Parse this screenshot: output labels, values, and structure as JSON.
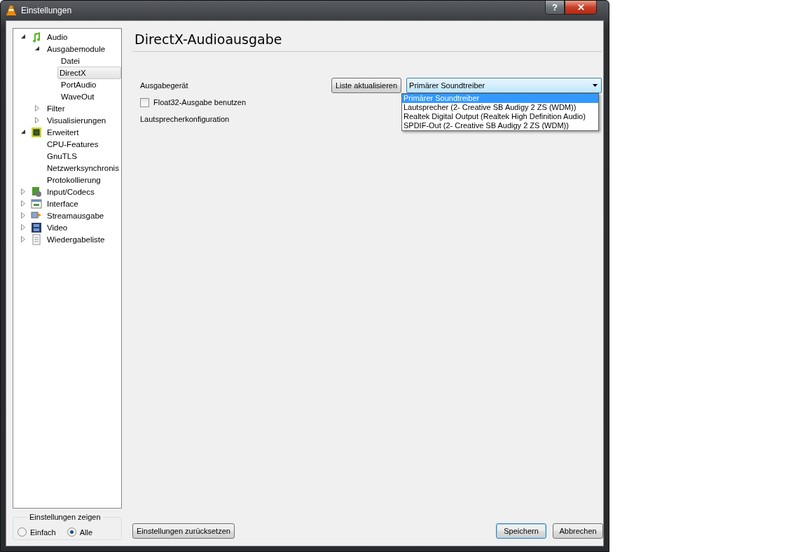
{
  "window": {
    "title": "Einstellungen",
    "help": "?",
    "close": "✕"
  },
  "tree": [
    {
      "label": "Audio",
      "expanded": true,
      "selected": false,
      "children": [
        {
          "label": "Ausgabemodule",
          "expanded": true,
          "selected": false,
          "children": [
            {
              "label": "Datei",
              "selected": false
            },
            {
              "label": "DirectX",
              "selected": true
            },
            {
              "label": "PortAudio",
              "selected": false
            },
            {
              "label": "WaveOut",
              "selected": false
            }
          ]
        },
        {
          "label": "Filter",
          "expanded": false,
          "selected": false
        },
        {
          "label": "Visualisierungen",
          "expanded": false,
          "selected": false
        }
      ]
    },
    {
      "label": "Erweitert",
      "expanded": true,
      "selected": false,
      "children": [
        {
          "label": "CPU-Features",
          "selected": false
        },
        {
          "label": "GnuTLS",
          "selected": false
        },
        {
          "label": "Netzwerksynchronis",
          "selected": false
        },
        {
          "label": "Protokollierung",
          "selected": false
        }
      ]
    },
    {
      "label": "Input/Codecs",
      "expanded": false,
      "selected": false
    },
    {
      "label": "Interface",
      "expanded": false,
      "selected": false
    },
    {
      "label": "Streamausgabe",
      "expanded": false,
      "selected": false
    },
    {
      "label": "Video",
      "expanded": false,
      "selected": false
    },
    {
      "label": "Wiedergabeliste",
      "expanded": false,
      "selected": false
    }
  ],
  "show_settings": {
    "title": "Einstellungen zeigen",
    "options": [
      {
        "label": "Einfach",
        "selected": false
      },
      {
        "label": "Alle",
        "selected": true
      }
    ]
  },
  "panel": {
    "title": "DirectX-Audioausgabe",
    "fields": [
      {
        "kind": "combo",
        "label": "Ausgabegerät",
        "button": "Liste aktualisieren",
        "value": "Primärer Soundtreiber",
        "open": true,
        "options": [
          {
            "label": "Primärer Soundtreiber",
            "selected": true
          },
          {
            "label": "Lautsprecher (2- Creative SB Audigy 2 ZS (WDM))",
            "selected": false
          },
          {
            "label": "Realtek Digital Output (Realtek High Definition Audio)",
            "selected": false
          },
          {
            "label": "SPDIF-Out (2- Creative SB Audigy 2 ZS (WDM))",
            "selected": false
          }
        ]
      },
      {
        "kind": "checkbox",
        "label": "Float32-Ausgabe benutzen",
        "checked": false
      },
      {
        "kind": "label",
        "label": "Lautsprecherkonfiguration"
      }
    ]
  },
  "footer": {
    "reset": "Einstellungen zurücksetzen",
    "buttons": [
      {
        "label": "Speichern",
        "default": true
      },
      {
        "label": "Abbrechen",
        "default": false
      }
    ]
  }
}
